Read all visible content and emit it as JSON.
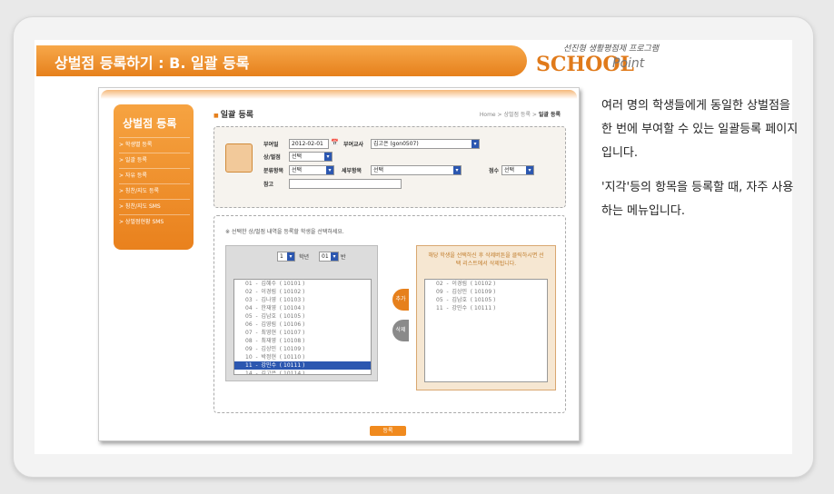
{
  "banner": {
    "title": "상벌점 등록하기 : B. 일괄 등록"
  },
  "logo": {
    "subtitle": "선진형 생활평점제 프로그램",
    "school": "SCHOOL",
    "point": "Point"
  },
  "shot": {
    "sidebar": {
      "heading": "상벌점 등록",
      "items": [
        "> 학생별 등록",
        "> 일괄 등록",
        "> 자유 등록",
        "> 칭찬/지도 등록",
        "> 칭찬/지도 SMS",
        "> 상벌점현황 SMS"
      ]
    },
    "page_title": "일괄 등록",
    "breadcrumb": {
      "path": "Home > 상벌점 등록 > ",
      "current": "일괄 등록"
    },
    "form": {
      "date_label": "부여일",
      "date_value": "2012-02-01",
      "teacher_label": "부여교사",
      "teacher_value": "김고은 (gon0507)",
      "type_label": "상/벌점",
      "type_value": "선택",
      "category_label": "분류항목",
      "category_value": "선택",
      "detail_label": "세부항목",
      "detail_value": "선택",
      "score_label": "점수",
      "score_value": "선택",
      "note_label": "참고"
    },
    "instruction": "※ 선택한 상/벌점 내역을 등록할 학생을 선택하세요.",
    "grade_value": "1",
    "grade_label": "학년",
    "class_value": "01",
    "class_label": "반",
    "students": [
      "01  -  김혜수  ( 10101 )",
      "02  -  이경림  ( 10102 )",
      "03  -  김나영  ( 10103 )",
      "04  -  한재영  ( 10104 )",
      "05  -  김남호  ( 10105 )",
      "06  -  김영림  ( 10106 )",
      "07  -  최영현  ( 10107 )",
      "08  -  최재영  ( 10108 )",
      "09  -  김상민  ( 10109 )",
      "10  -  박정현  ( 10110 )",
      "11  -  강민수  ( 10111 )",
      "14  -  김고은  ( 10114 )"
    ],
    "selected_student_index": 10,
    "right_message": "해당 학생을 선택하신 후 삭제버튼을 클릭하시면 선택 리스트에서 삭제됩니다.",
    "selected_students": [
      "02  -  이경림  ( 10102 )",
      "09  -  김상민  ( 10109 )",
      "05  -  김남호  ( 10105 )",
      "11  -  강민수  ( 10111 )"
    ],
    "add_button": "추가",
    "delete_button": "삭제",
    "submit_button": "등록"
  },
  "description": {
    "p1": "여러 명의 학생들에게 동일한 상벌점을 한 번에 부여할 수 있는 일괄등록 페이지입니다.",
    "p2": "'지각'등의 항목을 등록할 때, 자주 사용하는 메뉴입니다."
  },
  "colors": {
    "accent": "#e6801c",
    "select_blue": "#2c57b0"
  }
}
